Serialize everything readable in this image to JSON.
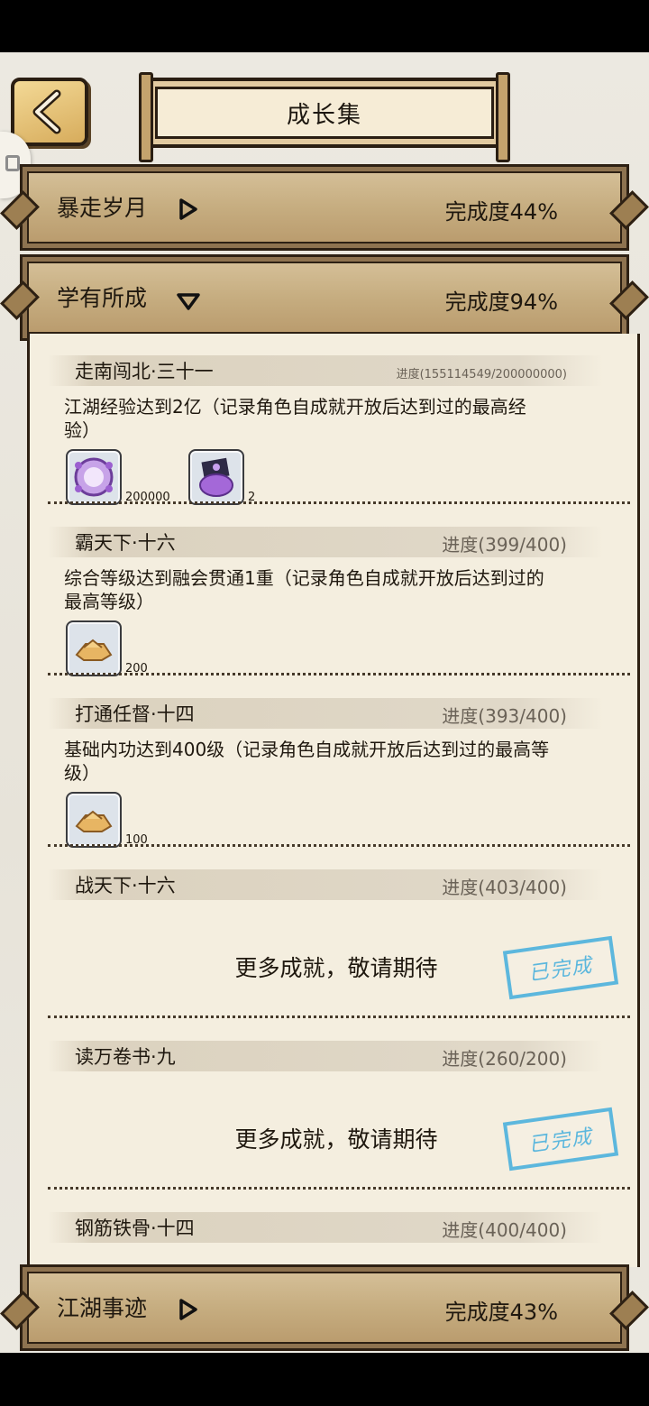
{
  "header": {
    "title": "成长集"
  },
  "sections": [
    {
      "title": "暴走岁月",
      "progress": "完成度44%"
    },
    {
      "title": "学有所成",
      "progress": "完成度94%"
    },
    {
      "title": "江湖事迹",
      "progress": "完成度43%"
    }
  ],
  "achievements": [
    {
      "name": "走南闯北·三十一",
      "progress": "进度(155114549/200000000)",
      "desc": "江湖经验达到2亿（记录角色自成就开放后达到过的最高经验）",
      "rewards": [
        {
          "icon": "purple-orb-icon",
          "count": "200000"
        },
        {
          "icon": "purple-bag-icon",
          "count": "2"
        }
      ]
    },
    {
      "name": "霸天下·十六",
      "progress": "进度(399/400)",
      "desc": "综合等级达到融会贯通1重（记录角色自成就开放后达到过的最高等级）",
      "rewards": [
        {
          "icon": "gold-ingot-icon",
          "count": "200"
        }
      ]
    },
    {
      "name": "打通任督·十四",
      "progress": "进度(393/400)",
      "desc": "基础内功达到400级（记录角色自成就开放后达到过的最高等级）",
      "rewards": [
        {
          "icon": "gold-ingot-icon",
          "count": "100"
        }
      ]
    },
    {
      "name": "战天下·十六",
      "progress": "进度(403/400)",
      "more": "更多成就，敬请期待",
      "stamp": "已完成"
    },
    {
      "name": "读万卷书·九",
      "progress": "进度(260/200)",
      "more": "更多成就，敬请期待",
      "stamp": "已完成"
    },
    {
      "name": "钢筋铁骨·十四",
      "progress": "进度(400/400)"
    }
  ]
}
